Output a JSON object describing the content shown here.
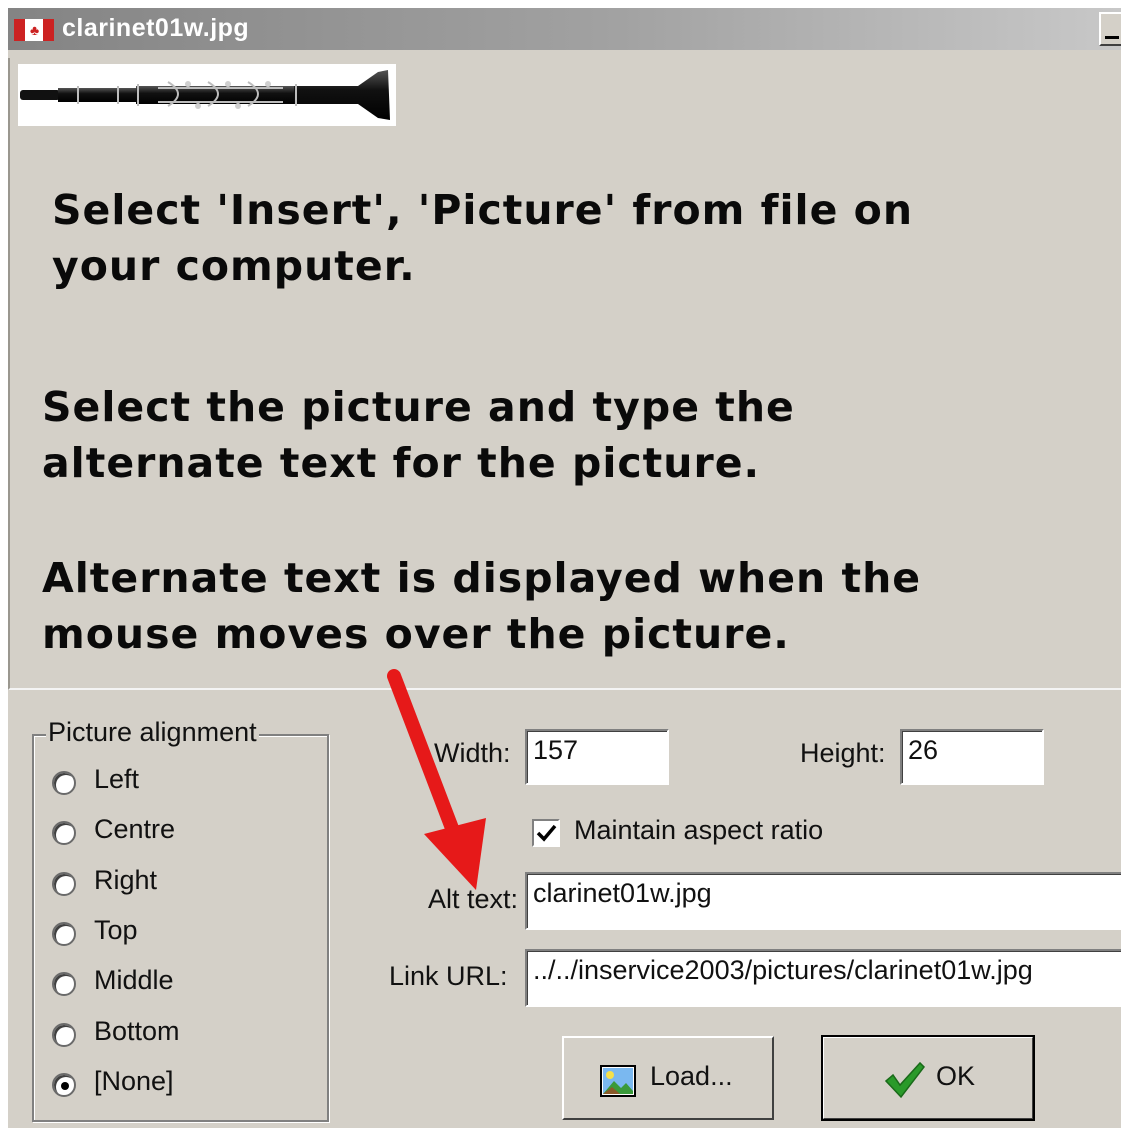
{
  "window": {
    "title": "clarinet01w.jpg",
    "icons": {
      "app": "canada-flag-icon",
      "minimize": "minimize-icon"
    }
  },
  "instructions": [
    "Select 'Insert', 'Picture' from file on your computer.",
    "Select the picture and type the alternate text for the picture.",
    "Alternate text is displayed when the mouse moves over the picture."
  ],
  "alignment": {
    "legend": "Picture alignment",
    "options": [
      "Left",
      "Centre",
      "Right",
      "Top",
      "Middle",
      "Bottom",
      "[None]"
    ],
    "selected": "[None]"
  },
  "dimensions": {
    "width_label": "Width:",
    "width_value": "157",
    "height_label": "Height:",
    "height_value": "26"
  },
  "aspect": {
    "label": "Maintain aspect ratio",
    "checked": true
  },
  "alt_text": {
    "label": "Alt text:",
    "value": "clarinet01w.jpg"
  },
  "link_url": {
    "label": "Link URL:",
    "value": "../../inservice2003/pictures/clarinet01w.jpg"
  },
  "buttons": {
    "load": "Load...",
    "ok": "OK"
  },
  "colors": {
    "dialog_bg": "#d4d0c8",
    "annotation_arrow": "#e61919",
    "ok_check": "#2a9a2a"
  }
}
